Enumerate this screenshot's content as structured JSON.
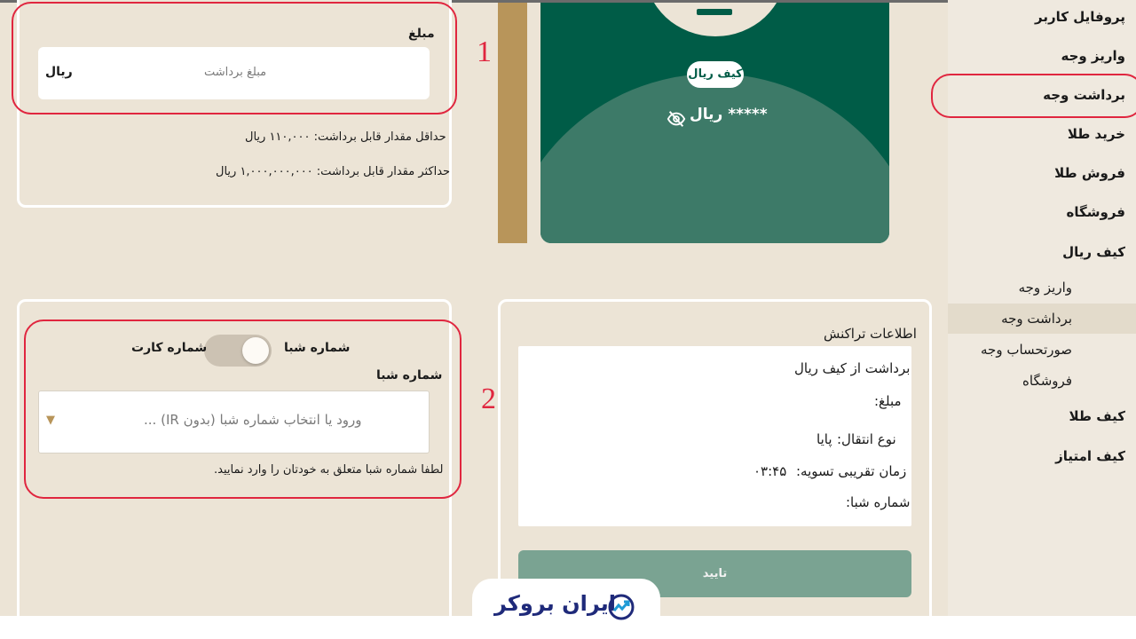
{
  "sidebar": {
    "items": [
      {
        "label": "پروفایل کاربر"
      },
      {
        "label": "واریز وجه"
      },
      {
        "label": "برداشت وجه"
      },
      {
        "label": "خرید طلا"
      },
      {
        "label": "فروش طلا"
      },
      {
        "label": "فروشگاه"
      },
      {
        "label": "کیف ریال"
      }
    ],
    "sub_items": [
      {
        "label": "واریز وجه"
      },
      {
        "label": "برداشت وجه"
      },
      {
        "label": "صورتحساب وجه"
      },
      {
        "label": "فروشگاه"
      }
    ],
    "bottom_items": [
      {
        "label": "کیف طلا"
      },
      {
        "label": "کیف امتیاز"
      }
    ]
  },
  "amount_panel": {
    "label": "مبلغ",
    "placeholder": "مبلغ برداشت",
    "currency": "ریال",
    "min_text": "حداقل مقدار قابل برداشت: ۱۱۰,۰۰۰ ریال",
    "max_text": "حداکثر مقدار قابل برداشت: ۱,۰۰۰,۰۰۰,۰۰۰ ریال"
  },
  "wallet_card": {
    "name": "کیف ریال",
    "balance": "***** ریال"
  },
  "destination_panel": {
    "toggle_left_label": "شماره کارت",
    "toggle_right_label": "شماره شبا",
    "field_label": "شماره شبا",
    "placeholder": "ورود یا انتخاب شماره شبا (بدون IR) ...",
    "hint": "لطفا شماره شبا متعلق به خودتان را وارد نمایید."
  },
  "transaction_info": {
    "title": "اطلاعات تراکنش",
    "type_line": "برداشت از کیف ریال",
    "amount_label": "مبلغ:",
    "transfer_label": "نوع انتقال:",
    "transfer_value": "پایا",
    "settle_label": "زمان تقریبی تسویه:",
    "settle_value": "۰۳:۴۵",
    "iban_label": "شماره شبا:",
    "confirm": "تایید"
  },
  "annotations": {
    "one": "1",
    "two": "2"
  },
  "logo": {
    "text": "ایران بروکر"
  },
  "colors": {
    "background": "#ece4d6",
    "card_dark": "#005c47",
    "card_light": "#3d7a68",
    "annotation": "#e0263f",
    "confirm": "#7aa392",
    "brand": "#1f2a7a"
  }
}
